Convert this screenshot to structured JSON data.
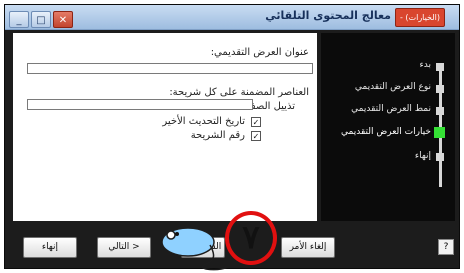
{
  "window": {
    "title": "معالج المحتوى التلقائي",
    "title_badge": "- (الخيارات)",
    "controls": {
      "minimize": "_",
      "maximize": "□",
      "close": "✕"
    }
  },
  "form": {
    "title_label": "عنوان العرض التقديمي:",
    "title_value": "",
    "footer_group_label": "العناصر المضمنة على كل شريحة:",
    "footer_label": "تذييل الصفحة:",
    "footer_value": "",
    "date_label": "تاريخ التحديث الأخير",
    "date_checked": true,
    "slide_number_label": "رقم الشريحة",
    "slide_number_checked": true
  },
  "steps": [
    {
      "label": "بدء",
      "active": false
    },
    {
      "label": "نوع العرض التقديمي",
      "active": false
    },
    {
      "label": "نمط العرض التقديمي",
      "active": false
    },
    {
      "label": "خيارات العرض التقديمي",
      "active": true
    },
    {
      "label": "إنهاء",
      "active": false
    }
  ],
  "buttons": {
    "cancel": "إلغاء الأمر",
    "back": "< السابق",
    "next": "التالي >",
    "finish": "إنهاء"
  },
  "help_icon": "help-icon",
  "overlay": {
    "number": "٧",
    "mouse_icon": "mouse-icon"
  },
  "colors": {
    "active_step": "#35e035",
    "circle": "#e11010",
    "mouse_body": "#8fd1ff"
  }
}
